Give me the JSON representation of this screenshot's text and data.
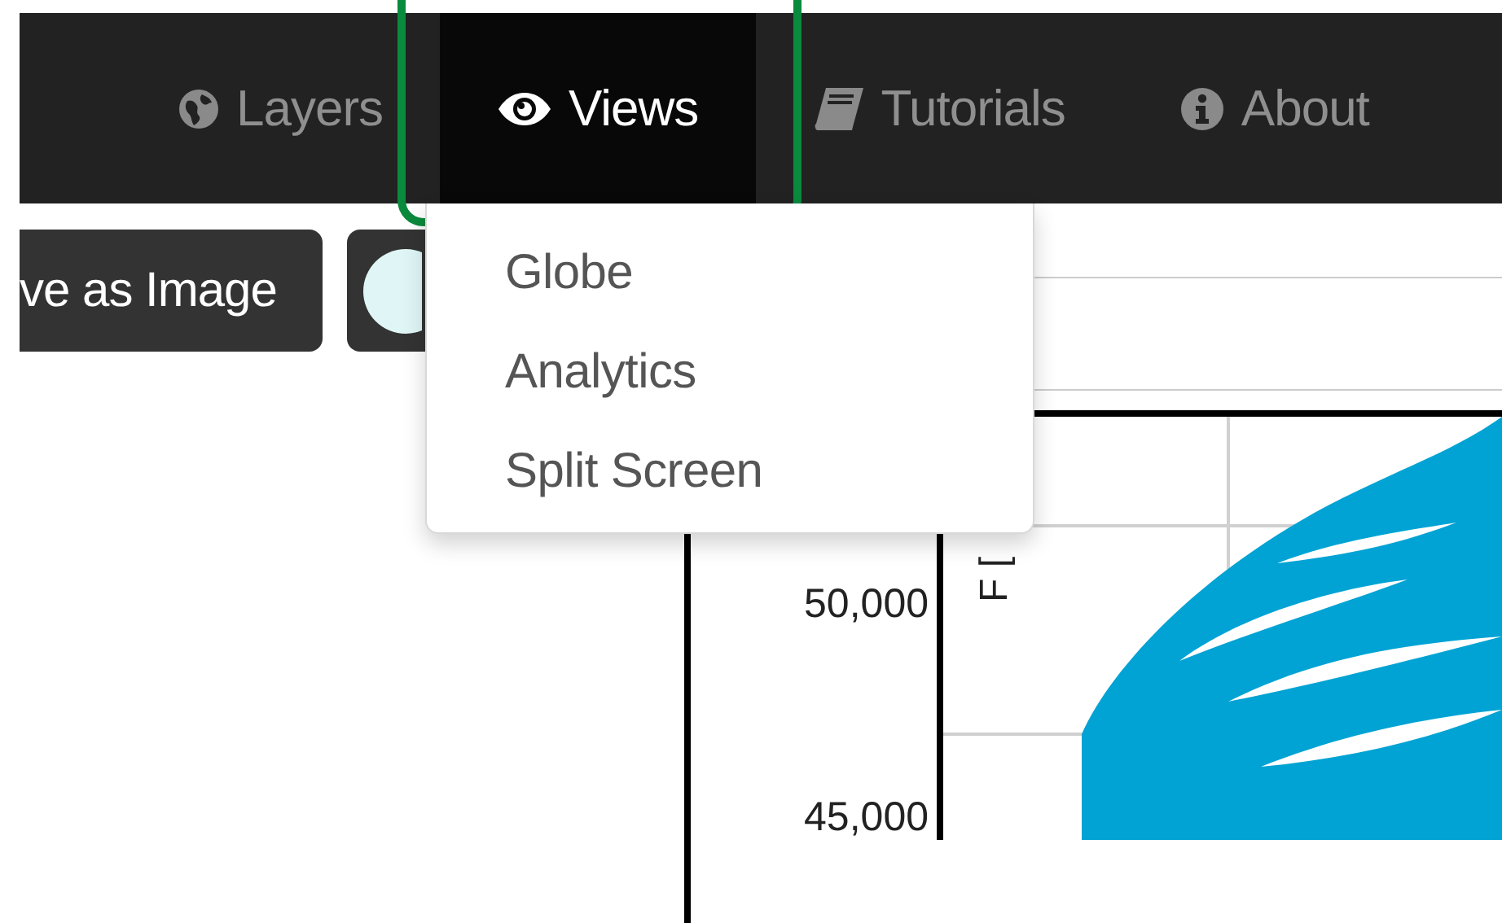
{
  "navbar": {
    "tabs": [
      {
        "label": "Layers",
        "selected": false,
        "highlighted": false
      },
      {
        "label": "Views",
        "selected": true,
        "highlighted": true
      },
      {
        "label": "Tutorials",
        "selected": false,
        "highlighted": false
      },
      {
        "label": "About",
        "selected": false,
        "highlighted": false
      }
    ]
  },
  "toolbar": {
    "buttons": [
      {
        "kind": "text",
        "label": "ve as Image"
      },
      {
        "kind": "toggle"
      }
    ]
  },
  "views_menu": {
    "items": [
      "Globe",
      "Analytics",
      "Split Screen"
    ]
  },
  "plot": {
    "y_axis_label": "F [",
    "y_ticks": [
      "50,000",
      "45,000"
    ]
  }
}
